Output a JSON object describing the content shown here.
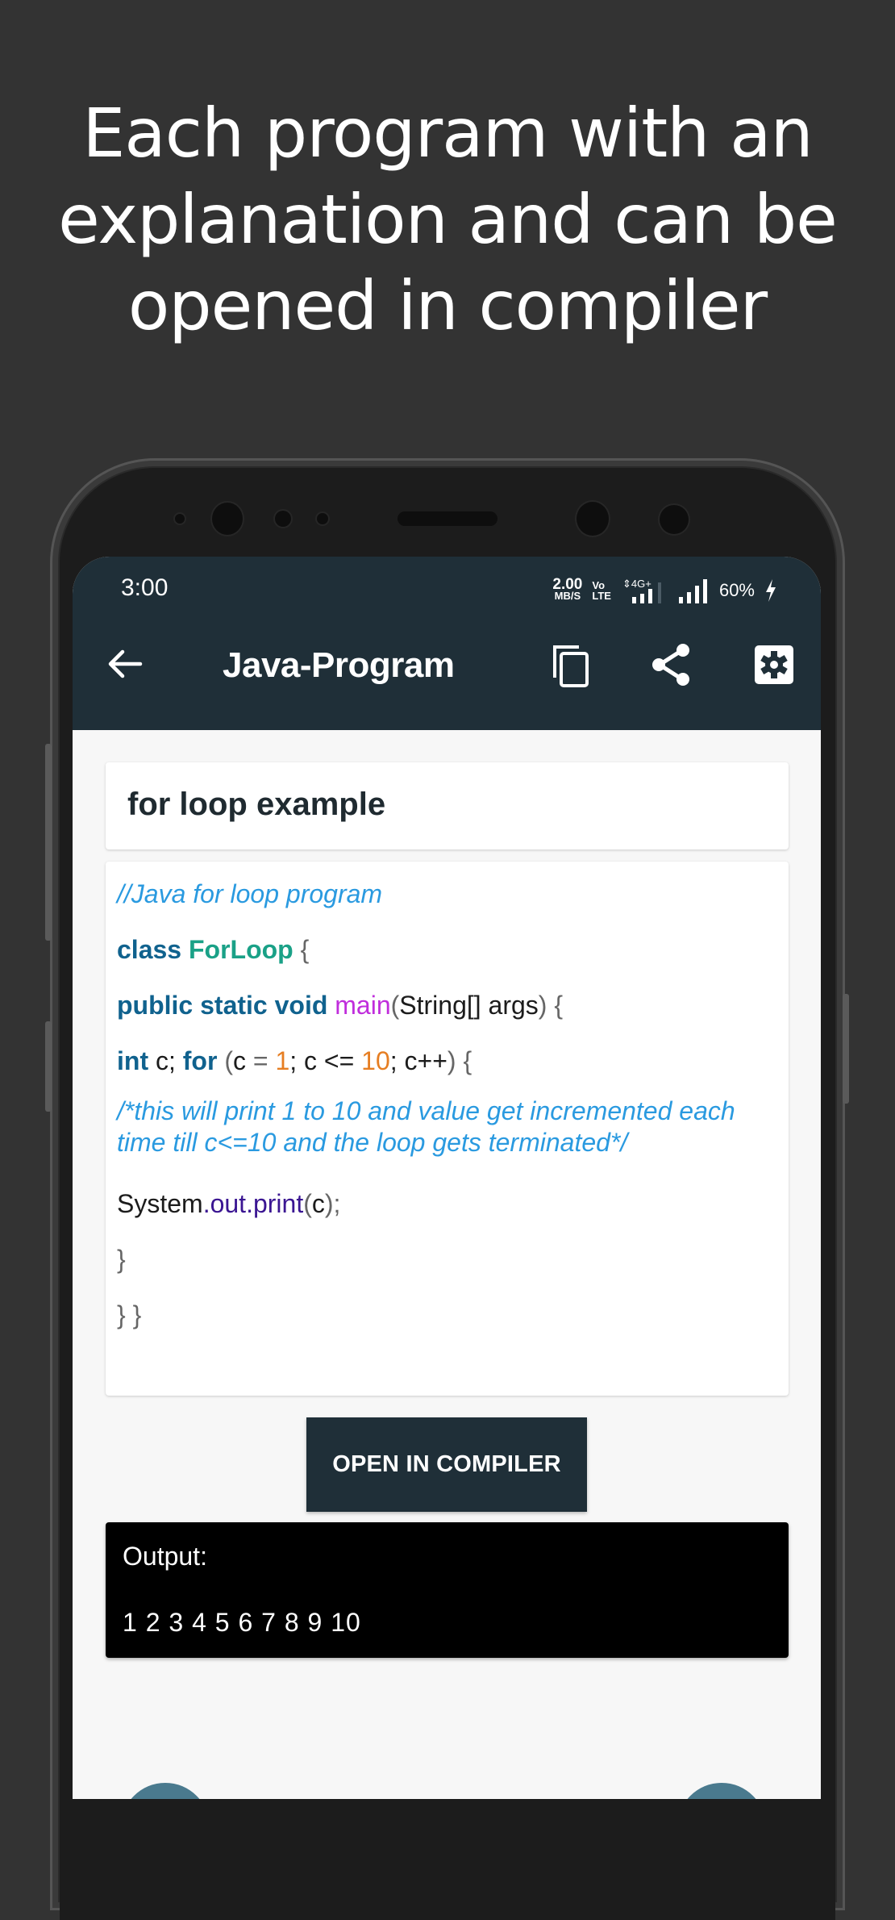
{
  "headline": {
    "lines": [
      "Each program with an",
      "explanation and can be",
      "opened in compiler"
    ]
  },
  "status_bar": {
    "time": "3:00",
    "net_speed_value": "2.00",
    "net_speed_unit": "MB/S",
    "volte_top": "Vo",
    "volte_bottom": "LTE",
    "network_type": "4G+",
    "battery": "60%",
    "charging": true
  },
  "toolbar": {
    "title": "Java-Program",
    "icons": [
      "back-arrow-icon",
      "copy-icon",
      "share-icon",
      "settings-icon"
    ],
    "color": "#1f2f38"
  },
  "program": {
    "title": "for loop example",
    "code_lines": [
      [
        {
          "t": "//Java for loop program",
          "k": "comment"
        }
      ],
      [
        {
          "t": "class ",
          "k": "kw"
        },
        {
          "t": "ForLoop",
          "k": "class"
        },
        {
          "t": " {",
          "k": "punc"
        }
      ],
      [
        {
          "t": "public static void ",
          "k": "kw"
        },
        {
          "t": "main",
          "k": "fn"
        },
        {
          "t": "(",
          "k": "punc"
        },
        {
          "t": "String[] args",
          "k": "plain"
        },
        {
          "t": ") {",
          "k": "punc"
        }
      ],
      [
        {
          "t": "int",
          "k": "kw"
        },
        {
          "t": " c; ",
          "k": "plain"
        },
        {
          "t": "for",
          "k": "kw"
        },
        {
          "t": " (",
          "k": "punc"
        },
        {
          "t": "c ",
          "k": "plain"
        },
        {
          "t": "= ",
          "k": "punc"
        },
        {
          "t": "1",
          "k": "num"
        },
        {
          "t": "; c <= ",
          "k": "plain"
        },
        {
          "t": "10",
          "k": "num"
        },
        {
          "t": "; c++",
          "k": "plain"
        },
        {
          "t": ") {",
          "k": "punc"
        }
      ],
      [
        {
          "t": "/*this will print 1 to 10 and value get incremented each time till c<=10 and the loop gets terminated*/",
          "k": "comment"
        }
      ],
      [
        {
          "t": "System",
          "k": "plain"
        },
        {
          "t": ".out.print",
          "k": "field"
        },
        {
          "t": "(",
          "k": "punc"
        },
        {
          "t": "c",
          "k": "plain"
        },
        {
          "t": ");",
          "k": "punc"
        }
      ],
      [
        {
          "t": "}",
          "k": "punc"
        }
      ],
      [
        {
          "t": "}     }",
          "k": "punc"
        }
      ]
    ]
  },
  "actions": {
    "open_compiler_label": "OPEN IN COMPILER"
  },
  "output": {
    "label": "Output:",
    "value": "1 2 3 4 5 6 7 8 9 10"
  }
}
